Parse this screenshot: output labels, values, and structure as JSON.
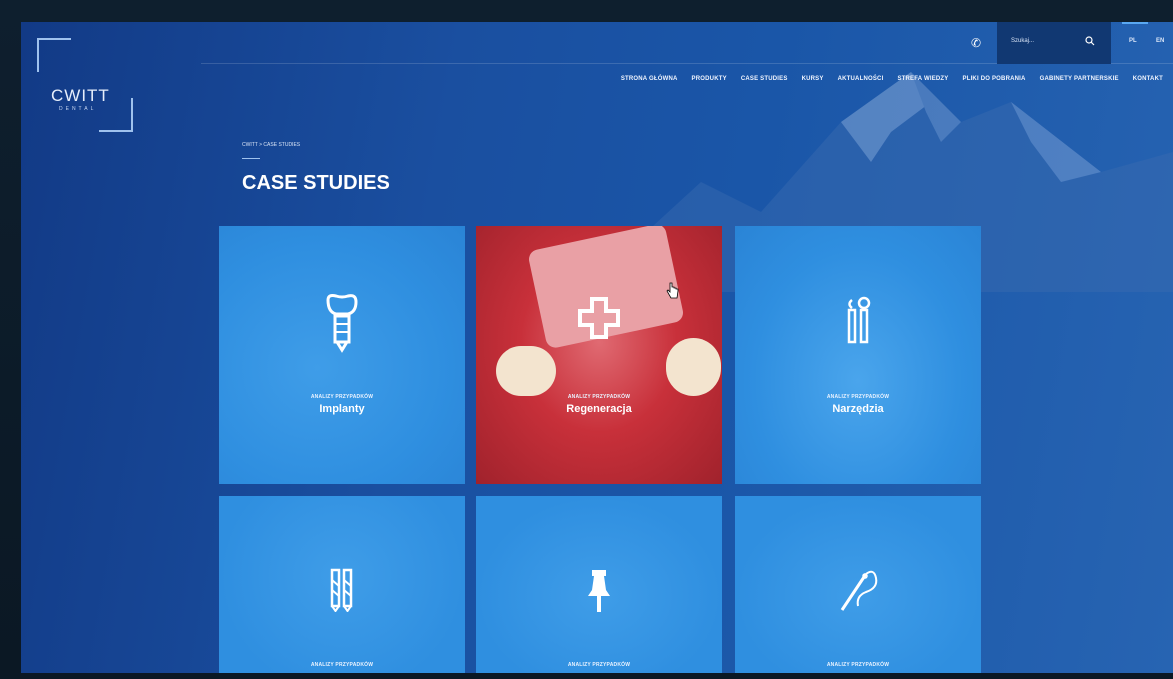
{
  "brand": {
    "name": "CWITT",
    "sub": "DENTAL"
  },
  "topbar": {
    "search_placeholder": "Szukaj...",
    "lang_pl": "PL",
    "lang_en": "EN"
  },
  "nav": [
    "STRONA GŁÓWNA",
    "PRODUKTY",
    "CASE STUDIES",
    "KURSY",
    "AKTUALNOŚCI",
    "STREFA WIEDZY",
    "PLIKI DO POBRANIA",
    "GABINETY PARTNERSKIE",
    "KONTAKT"
  ],
  "breadcrumb": "CWITT  >  CASE STUDIES",
  "page_title": "CASE STUDIES",
  "tiles": [
    {
      "eyebrow": "ANALIZY PRZYPADKÓW",
      "label": "Implanty",
      "icon": "implant-icon"
    },
    {
      "eyebrow": "ANALIZY PRZYPADKÓW",
      "label": "Regeneracja",
      "icon": "cross-icon"
    },
    {
      "eyebrow": "ANALIZY PRZYPADKÓW",
      "label": "Narzędzia",
      "icon": "dental-tools-icon"
    },
    {
      "eyebrow": "ANALIZY PRZYPADKÓW",
      "label": "",
      "icon": "drill-icon"
    },
    {
      "eyebrow": "ANALIZY PRZYPADKÓW",
      "label": "",
      "icon": "pin-icon"
    },
    {
      "eyebrow": "ANALIZY PRZYPADKÓW",
      "label": "",
      "icon": "suture-icon"
    }
  ],
  "colors": {
    "accent": "#59a8f2",
    "tile_blue": "#2f8fe0",
    "tile_red": "#c8303a"
  }
}
